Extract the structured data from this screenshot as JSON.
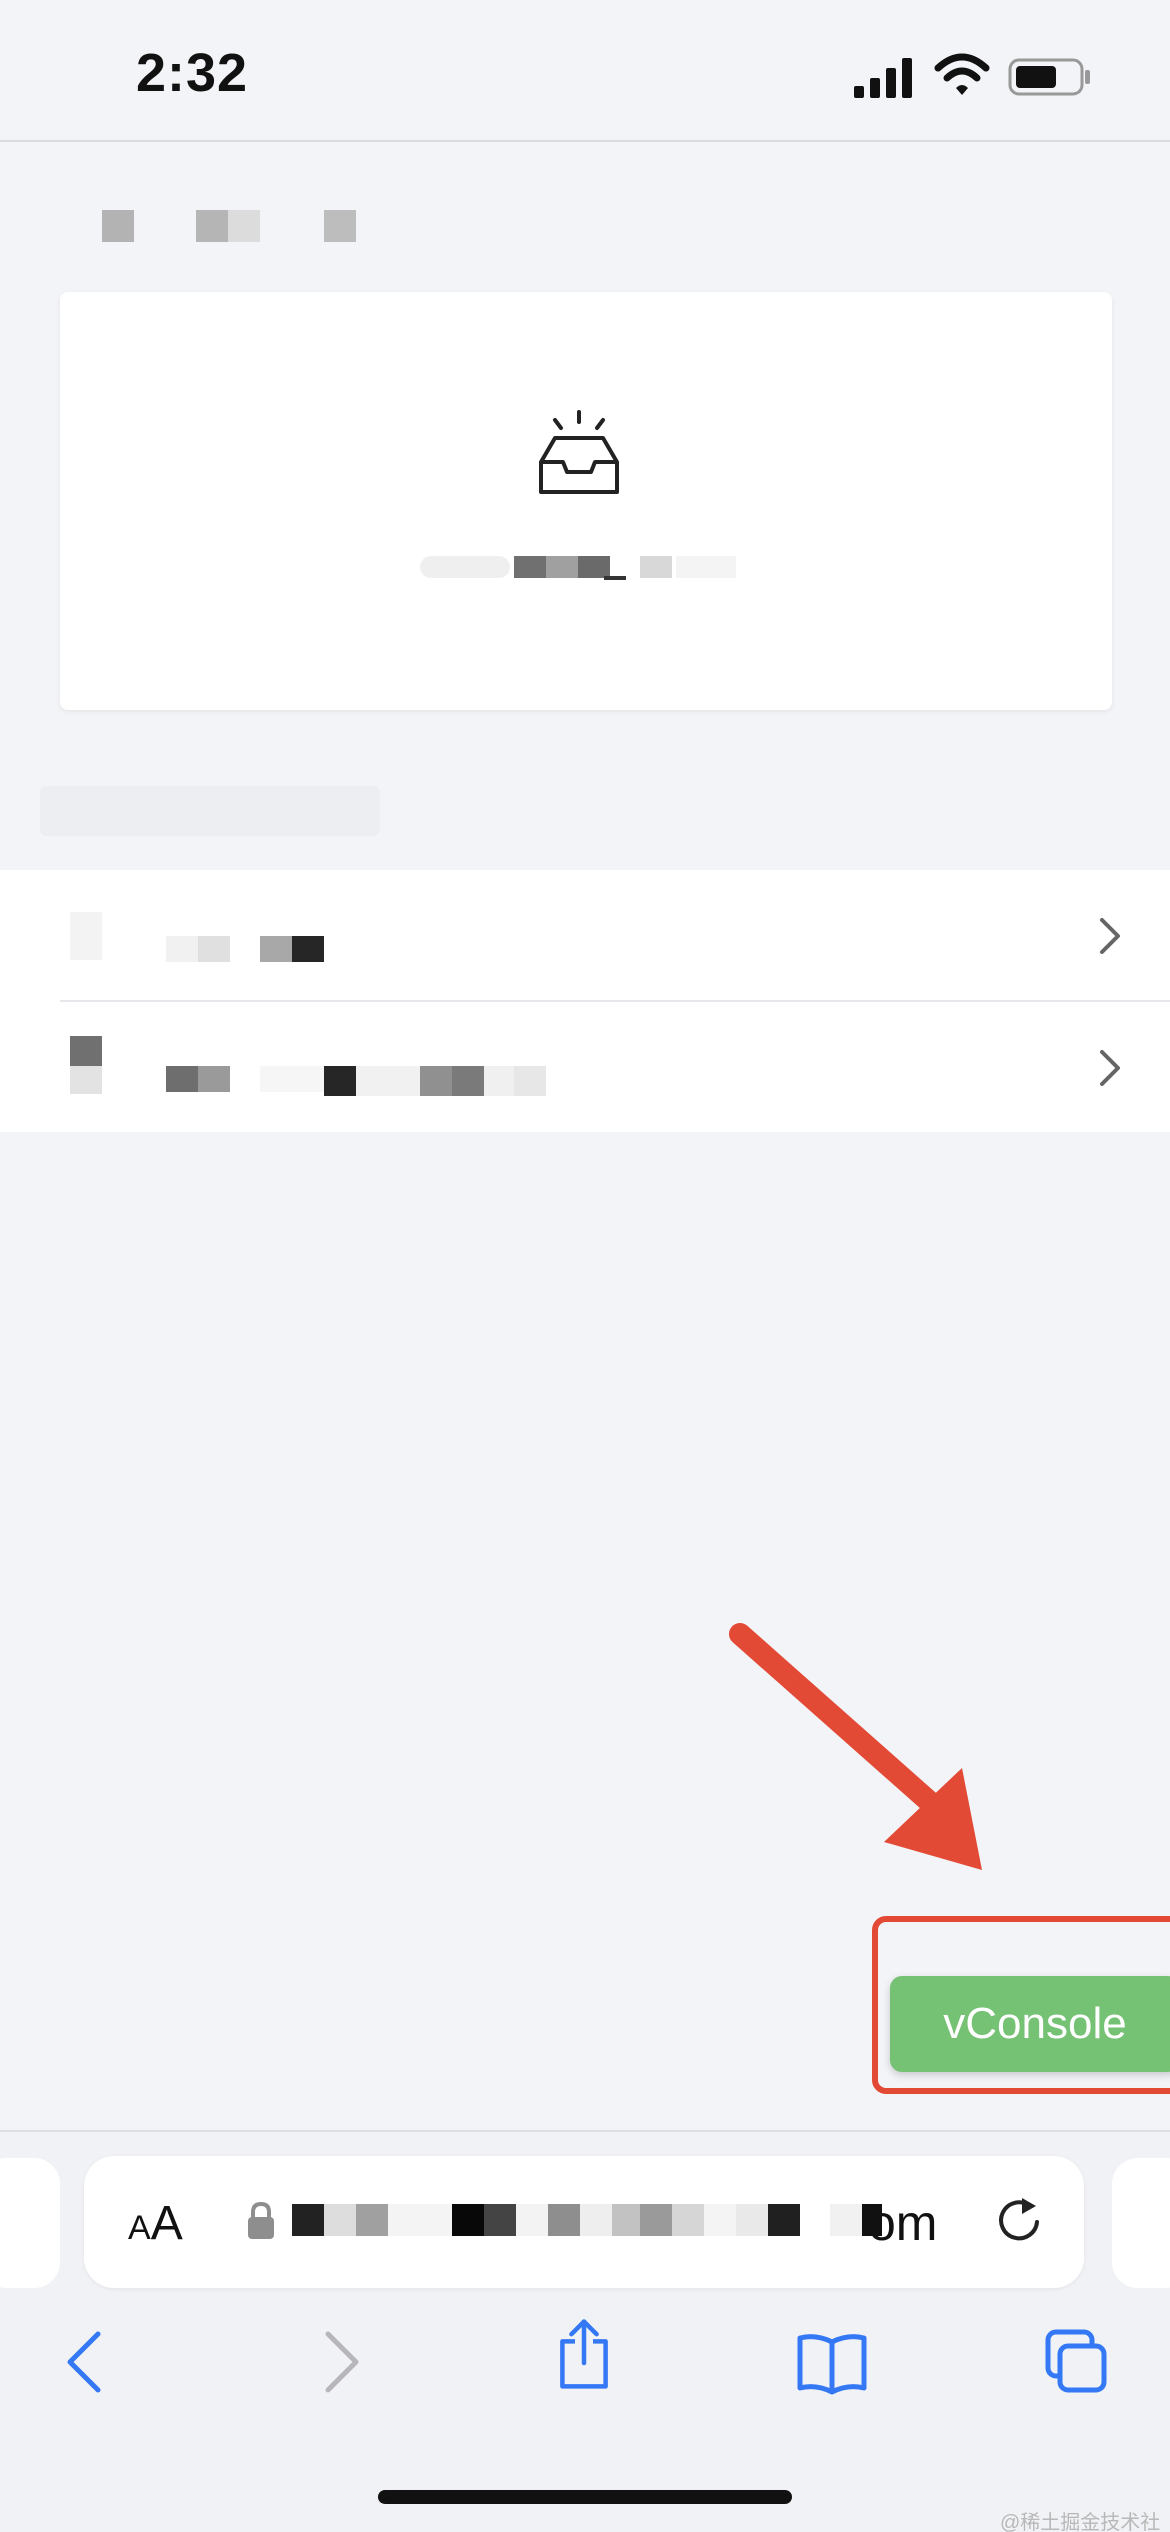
{
  "status_bar": {
    "time": "2:32"
  },
  "vconsole": {
    "label": "vConsole"
  },
  "address_bar": {
    "text_size_label_small": "A",
    "text_size_label_large": "A",
    "url_visible_suffix": "om"
  },
  "watermark": {
    "text": "@稀土掘金技术社区"
  },
  "colors": {
    "background": "#f3f4f7",
    "card": "#ffffff",
    "vconsole_green": "#76c274",
    "annotation_red": "#e24a36",
    "safari_blue": "#3478f6"
  },
  "icons": {
    "card": "inbox-icon",
    "list_chevron": "chevron-right-icon",
    "toolbar": [
      "back-icon",
      "forward-icon",
      "share-icon",
      "bookmarks-icon",
      "tabs-icon"
    ]
  }
}
